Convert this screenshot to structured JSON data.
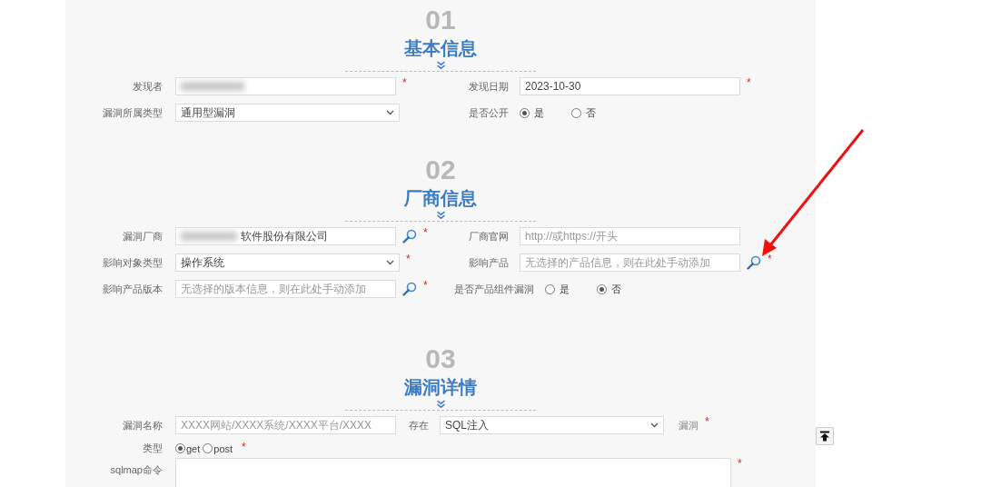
{
  "sections": [
    {
      "number": "01",
      "title": "基本信息",
      "rows": [
        {
          "cells": [
            {
              "kind": "text",
              "label": "发现者",
              "redacted": true,
              "required_mark": "*"
            },
            {
              "kind": "text",
              "label": "发现日期",
              "value": "2023-10-30",
              "required_mark": "*"
            }
          ]
        },
        {
          "cells": [
            {
              "kind": "select",
              "label": "漏洞所属类型",
              "value": "通用型漏洞"
            },
            {
              "kind": "radio",
              "label": "是否公开",
              "options": [
                {
                  "label": "是",
                  "selected": true
                },
                {
                  "label": "否",
                  "selected": false
                }
              ]
            }
          ]
        }
      ]
    },
    {
      "number": "02",
      "title": "厂商信息",
      "rows": [
        {
          "cells": [
            {
              "kind": "text",
              "label": "漏洞厂商",
              "redacted": true,
              "value": "软件股份有限公司",
              "lookup": true,
              "required_mark": "*"
            },
            {
              "kind": "text",
              "label": "厂商官网",
              "placeholder": "http://或https://开头"
            }
          ]
        },
        {
          "cells": [
            {
              "kind": "select",
              "label": "影响对象类型",
              "value": "操作系统",
              "required_mark": "*"
            },
            {
              "kind": "text",
              "label": "影响产品",
              "placeholder": "无选择的产品信息，则在此处手动添加",
              "lookup": true,
              "required_mark": "*"
            }
          ]
        },
        {
          "cells": [
            {
              "kind": "text",
              "label": "影响产品版本",
              "placeholder": "无选择的版本信息，则在此处手动添加",
              "lookup": true,
              "required_mark": "*"
            },
            {
              "kind": "radio",
              "label": "是否产品组件漏洞",
              "options": [
                {
                  "label": "是",
                  "selected": false
                },
                {
                  "label": "否",
                  "selected": true
                }
              ]
            }
          ]
        }
      ]
    },
    {
      "number": "03",
      "title": "漏洞详情",
      "rows": [
        {
          "cells": [
            {
              "kind": "text",
              "label": "漏洞名称",
              "placeholder": "XXXX网站/XXXX系统/XXXX平台/XXXX"
            },
            {
              "kind": "select",
              "label": "存在",
              "value": "SQL注入",
              "suffix": "漏洞",
              "required_mark": "*"
            }
          ]
        },
        {
          "cells": [
            {
              "kind": "radio_compact",
              "label": "类型",
              "options": [
                {
                  "label": "get",
                  "selected": true
                },
                {
                  "label": "post",
                  "selected": false
                }
              ],
              "required_mark": "*"
            }
          ]
        },
        {
          "cells": [
            {
              "kind": "textarea",
              "label": "sqlmap命令",
              "required_mark": "*"
            }
          ]
        }
      ]
    }
  ]
}
